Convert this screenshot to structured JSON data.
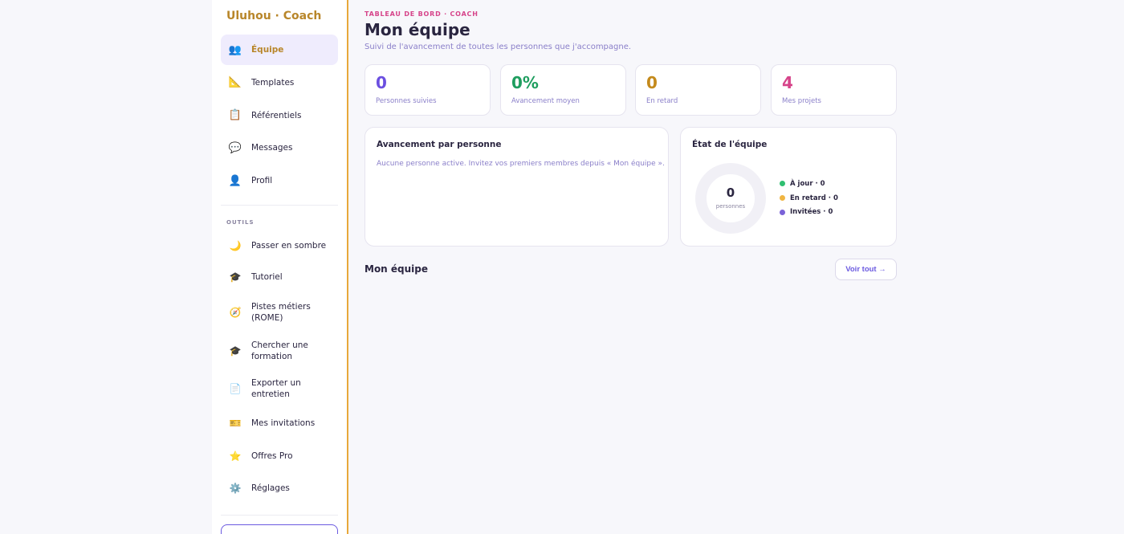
{
  "app": {
    "brand": "Uluhou · Coach"
  },
  "sidebar": {
    "nav": [
      {
        "label": "Équipe",
        "icon": "👥",
        "icon_name": "team-icon",
        "active": true
      },
      {
        "label": "Templates",
        "icon": "📐",
        "icon_name": "ruler-icon",
        "active": false
      },
      {
        "label": "Référentiels",
        "icon": "📋",
        "icon_name": "clipboard-icon",
        "active": false
      },
      {
        "label": "Messages",
        "icon": "💬",
        "icon_name": "chat-icon",
        "active": false
      },
      {
        "label": "Profil",
        "icon": "👤",
        "icon_name": "user-icon",
        "active": false
      }
    ],
    "tools_title": "OUTILS",
    "tools": [
      {
        "label": "Passer en sombre",
        "icon": "🌙",
        "icon_name": "moon-icon"
      },
      {
        "label": "Tutoriel",
        "icon": "🎓",
        "icon_name": "graduation-cap-icon"
      },
      {
        "label": "Pistes métiers (ROME)",
        "icon": "🧭",
        "icon_name": "compass-icon"
      },
      {
        "label": "Chercher une formation",
        "icon": "🎓",
        "icon_name": "graduation-cap-icon"
      },
      {
        "label": "Exporter un entretien",
        "icon": "📄",
        "icon_name": "document-icon"
      },
      {
        "label": "Mes invitations",
        "icon": "🎫",
        "icon_name": "ticket-icon"
      },
      {
        "label": "Offres Pro",
        "icon": "⭐",
        "icon_name": "star-icon"
      },
      {
        "label": "Réglages",
        "icon": "⚙️",
        "icon_name": "gear-icon"
      }
    ]
  },
  "header": {
    "eyebrow": "TABLEAU DE BORD · COACH",
    "title": "Mon équipe",
    "subtitle": "Suivi de l'avancement de toutes les personnes que j'accompagne."
  },
  "stats": [
    {
      "value": "0",
      "label": "Personnes suivies",
      "color": "#6b4fe0"
    },
    {
      "value": "0%",
      "label": "Avancement moyen",
      "color": "#1f9e5f"
    },
    {
      "value": "0",
      "label": "En retard",
      "color": "#c48a1c"
    },
    {
      "value": "4",
      "label": "Mes projets",
      "color": "#d6448a"
    }
  ],
  "progress_card": {
    "title": "Avancement par personne",
    "empty_text": "Aucune personne active. Invitez vos premiers membres depuis « Mon équipe »."
  },
  "team_state": {
    "title": "État de l'équipe",
    "total": "0",
    "total_label": "personnes",
    "legend": [
      {
        "label": "À jour · 0",
        "color": "#2fbf71"
      },
      {
        "label": "En retard · 0",
        "color": "#f0b542"
      },
      {
        "label": "Invitées · 0",
        "color": "#7a62d8"
      }
    ]
  },
  "team_section": {
    "title": "Mon équipe",
    "see_all": "Voir tout →"
  }
}
